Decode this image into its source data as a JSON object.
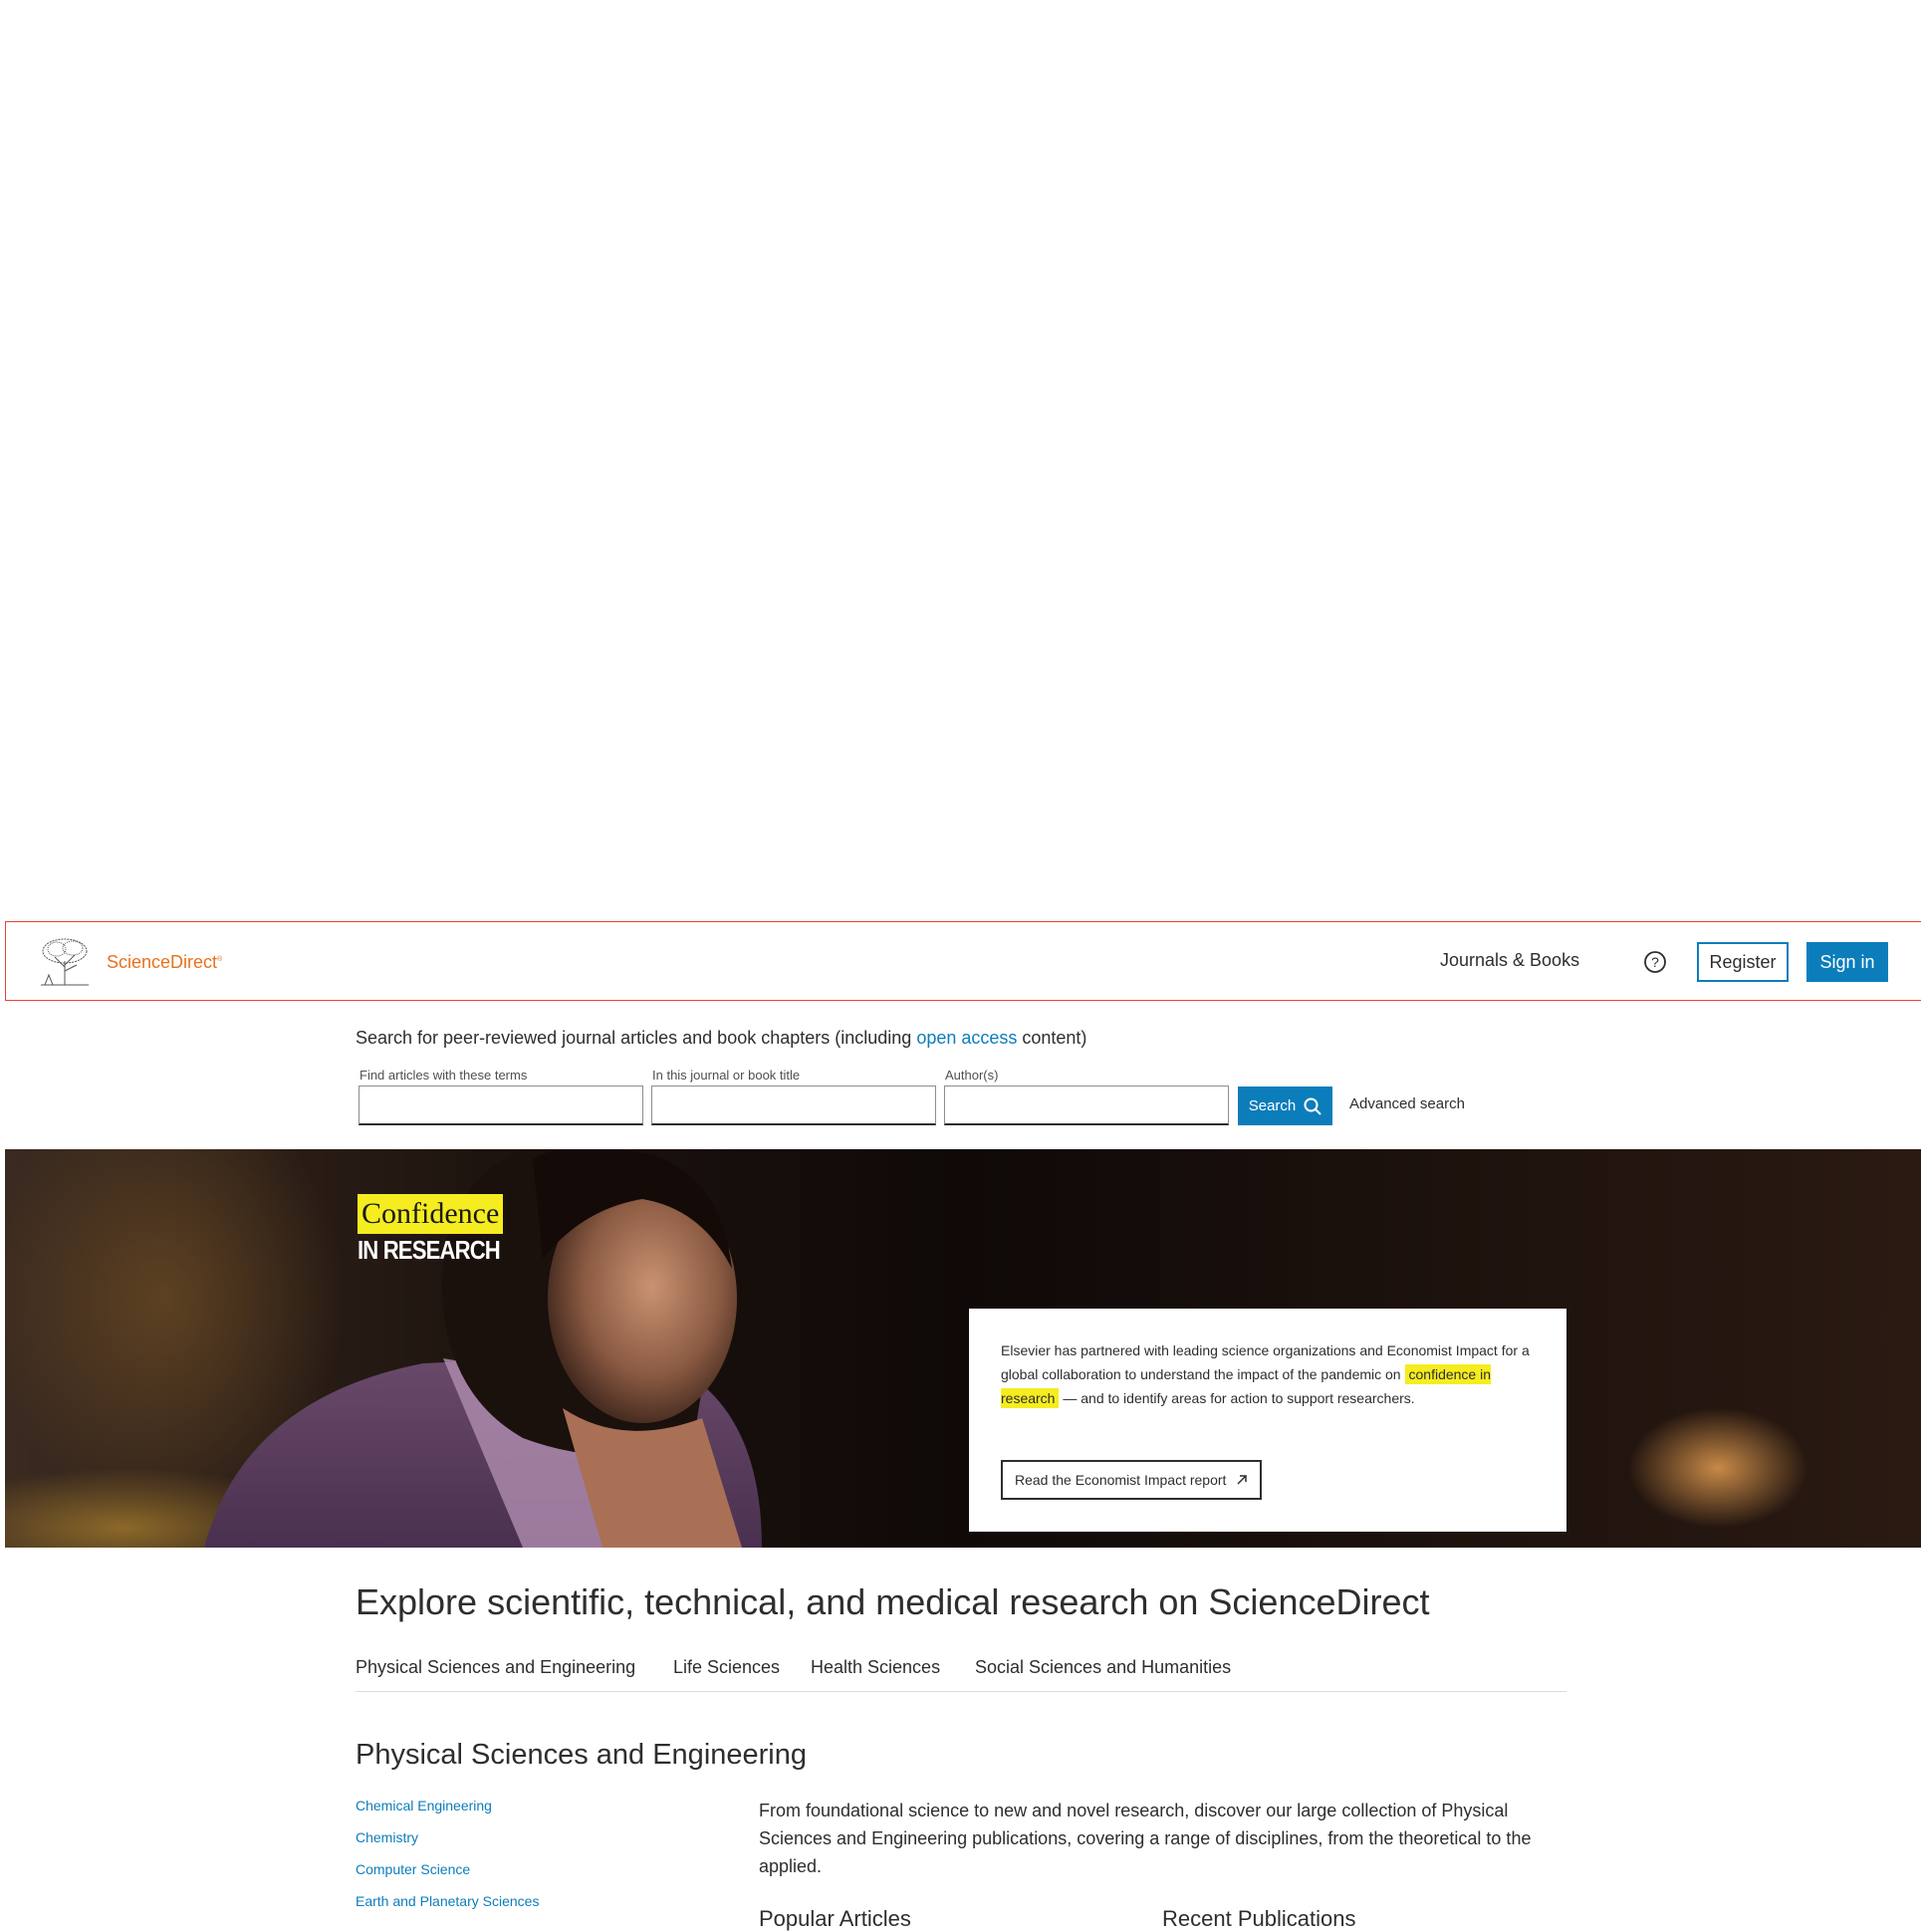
{
  "header": {
    "logo_text": "ScienceDirect",
    "logo_mark": "®",
    "nav_journals": "Journals & Books",
    "help_icon": "question-circle-icon",
    "register": "Register",
    "signin": "Sign in"
  },
  "search": {
    "intro_before": "Search for peer-reviewed journal articles and book chapters (including ",
    "intro_link": "open access",
    "intro_after": " content)",
    "fields": [
      {
        "label": "Find articles with these terms",
        "value": ""
      },
      {
        "label": "In this journal or book title",
        "value": ""
      },
      {
        "label": "Author(s)",
        "value": ""
      }
    ],
    "button": "Search",
    "button_icon": "search-icon",
    "advanced": "Advanced search"
  },
  "hero": {
    "badge_line1": "Confidence",
    "badge_line2": "IN RESEARCH",
    "card_text_before": "Elsevier has partnered with leading science organizations and Economist Impact for a global collaboration to understand the impact of the pandemic on ",
    "card_highlight": "confidence in research",
    "card_text_after": " — and to identify areas for action to support researchers.",
    "card_button": "Read the Economist Impact report",
    "card_button_icon": "external-arrow-icon"
  },
  "explore": {
    "title": "Explore scientific, technical, and medical research on ScienceDirect",
    "tabs": [
      "Physical Sciences and Engineering",
      "Life Sciences",
      "Health Sciences",
      "Social Sciences and Humanities"
    ]
  },
  "section": {
    "title": "Physical Sciences and Engineering",
    "links": [
      "Chemical Engineering",
      "Chemistry",
      "Computer Science",
      "Earth and Planetary Sciences"
    ],
    "description": "From foundational science to new and novel research, discover our large collection of Physical Sciences and Engineering publications, covering a range of disciplines, from the theoretical to the applied.",
    "subheads": [
      "Popular Articles",
      "Recent Publications"
    ]
  },
  "colors": {
    "brand_orange": "#e9711c",
    "link_blue": "#0c7dbb",
    "highlight_yellow": "#f5ed1f"
  }
}
